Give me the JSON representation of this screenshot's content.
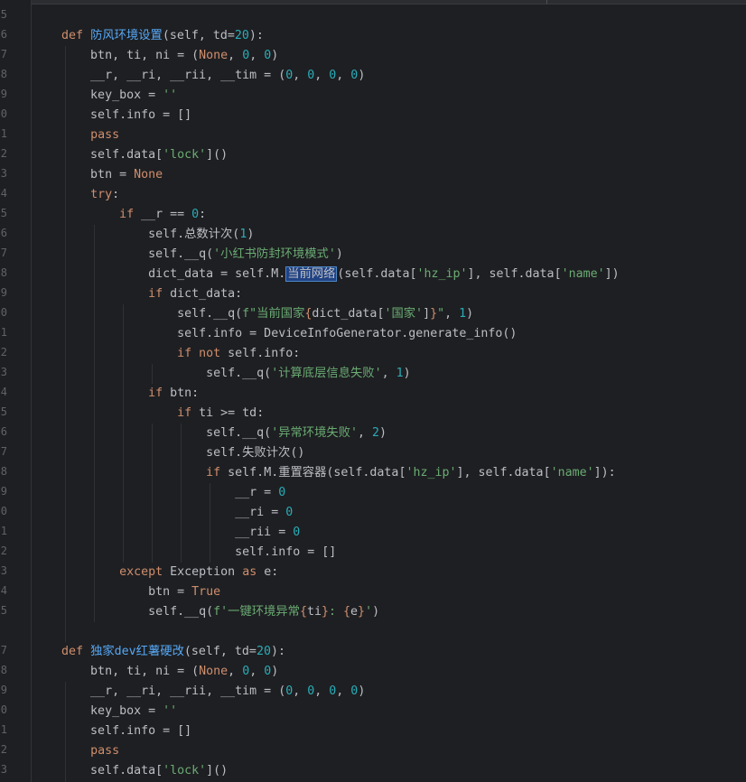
{
  "editor": {
    "line_numbers": [
      "5",
      "6",
      "7",
      "8",
      "9",
      "0",
      "1",
      "2",
      "3",
      "4",
      "5",
      "6",
      "7",
      "8",
      "9",
      "0",
      "1",
      "2",
      "3",
      "4",
      "5",
      "6",
      "7",
      "8",
      "9",
      "0",
      "1",
      "2",
      "3",
      "4",
      "5",
      "",
      "7",
      "8",
      "9",
      "0",
      "1",
      "2",
      "3"
    ],
    "code_lines": [
      [],
      [
        {
          "t": "def ",
          "c": "kw"
        },
        {
          "t": "防风环境设置",
          "c": "fn"
        },
        {
          "t": "(self, td="
        },
        {
          "t": "20",
          "c": "num"
        },
        {
          "t": "):"
        }
      ],
      [
        {
          "t": "    btn, ti, ni = ("
        },
        {
          "t": "None",
          "c": "kw"
        },
        {
          "t": ", "
        },
        {
          "t": "0",
          "c": "num"
        },
        {
          "t": ", "
        },
        {
          "t": "0",
          "c": "num"
        },
        {
          "t": ")"
        }
      ],
      [
        {
          "t": "    __r, __ri, __rii, __tim = ("
        },
        {
          "t": "0",
          "c": "num"
        },
        {
          "t": ", "
        },
        {
          "t": "0",
          "c": "num"
        },
        {
          "t": ", "
        },
        {
          "t": "0",
          "c": "num"
        },
        {
          "t": ", "
        },
        {
          "t": "0",
          "c": "num"
        },
        {
          "t": ")"
        }
      ],
      [
        {
          "t": "    key_box = "
        },
        {
          "t": "''",
          "c": "str"
        }
      ],
      [
        {
          "t": "    self.info = []"
        }
      ],
      [
        {
          "t": "    "
        },
        {
          "t": "pass",
          "c": "kw"
        }
      ],
      [
        {
          "t": "    self.data["
        },
        {
          "t": "'lock'",
          "c": "str"
        },
        {
          "t": "]()"
        }
      ],
      [
        {
          "t": "    btn = "
        },
        {
          "t": "None",
          "c": "kw"
        }
      ],
      [
        {
          "t": "    "
        },
        {
          "t": "try",
          "c": "kw"
        },
        {
          "t": ":"
        }
      ],
      [
        {
          "t": "        "
        },
        {
          "t": "if",
          "c": "kw"
        },
        {
          "t": " __r == "
        },
        {
          "t": "0",
          "c": "num"
        },
        {
          "t": ":"
        }
      ],
      [
        {
          "t": "            self.总数计次("
        },
        {
          "t": "1",
          "c": "num"
        },
        {
          "t": ")"
        }
      ],
      [
        {
          "t": "            self.__q("
        },
        {
          "t": "'小红书防封环境模式'",
          "c": "str"
        },
        {
          "t": ")"
        }
      ],
      [
        {
          "t": "            dict_data = self.M."
        },
        {
          "t": "当前网络",
          "c": "sel"
        },
        {
          "t": "(self.data["
        },
        {
          "t": "'hz_ip'",
          "c": "str"
        },
        {
          "t": "], self.data["
        },
        {
          "t": "'name'",
          "c": "str"
        },
        {
          "t": "])"
        }
      ],
      [
        {
          "t": "            "
        },
        {
          "t": "if",
          "c": "kw"
        },
        {
          "t": " dict_data:"
        }
      ],
      [
        {
          "t": "                self.__q("
        },
        {
          "t": "f\"当前国家",
          "c": "str"
        },
        {
          "t": "{",
          "c": "kw"
        },
        {
          "t": "dict_data["
        },
        {
          "t": "'国家'",
          "c": "str"
        },
        {
          "t": "]"
        },
        {
          "t": "}",
          "c": "kw"
        },
        {
          "t": "\"",
          "c": "str"
        },
        {
          "t": ", "
        },
        {
          "t": "1",
          "c": "num"
        },
        {
          "t": ")"
        }
      ],
      [
        {
          "t": "                self.info = DeviceInfoGenerator.generate_info()"
        }
      ],
      [
        {
          "t": "                "
        },
        {
          "t": "if not",
          "c": "kw"
        },
        {
          "t": " self.info:"
        }
      ],
      [
        {
          "t": "                    self.__q("
        },
        {
          "t": "'计算底层信息失败'",
          "c": "str"
        },
        {
          "t": ", "
        },
        {
          "t": "1",
          "c": "num"
        },
        {
          "t": ")"
        }
      ],
      [
        {
          "t": "            "
        },
        {
          "t": "if",
          "c": "kw"
        },
        {
          "t": " btn:"
        }
      ],
      [
        {
          "t": "                "
        },
        {
          "t": "if",
          "c": "kw"
        },
        {
          "t": " ti >= td:"
        }
      ],
      [
        {
          "t": "                    self.__q("
        },
        {
          "t": "'异常环境失败'",
          "c": "str"
        },
        {
          "t": ", "
        },
        {
          "t": "2",
          "c": "num"
        },
        {
          "t": ")"
        }
      ],
      [
        {
          "t": "                    self.失败计次()"
        }
      ],
      [
        {
          "t": "                    "
        },
        {
          "t": "if",
          "c": "kw"
        },
        {
          "t": " self.M.重置容器(self.data["
        },
        {
          "t": "'hz_ip'",
          "c": "str"
        },
        {
          "t": "], self.data["
        },
        {
          "t": "'name'",
          "c": "str"
        },
        {
          "t": "]):"
        }
      ],
      [
        {
          "t": "                        __r = "
        },
        {
          "t": "0",
          "c": "num"
        }
      ],
      [
        {
          "t": "                        __ri = "
        },
        {
          "t": "0",
          "c": "num"
        }
      ],
      [
        {
          "t": "                        __rii = "
        },
        {
          "t": "0",
          "c": "num"
        }
      ],
      [
        {
          "t": "                        self.info = []"
        }
      ],
      [
        {
          "t": "        "
        },
        {
          "t": "except",
          "c": "kw"
        },
        {
          "t": " Exception "
        },
        {
          "t": "as",
          "c": "kw"
        },
        {
          "t": " e:"
        }
      ],
      [
        {
          "t": "            btn = "
        },
        {
          "t": "True",
          "c": "kw"
        }
      ],
      [
        {
          "t": "            self.__q("
        },
        {
          "t": "f'一键环境异常",
          "c": "str"
        },
        {
          "t": "{",
          "c": "kw"
        },
        {
          "t": "ti"
        },
        {
          "t": "}",
          "c": "kw"
        },
        {
          "t": ": ",
          "c": "str"
        },
        {
          "t": "{",
          "c": "kw"
        },
        {
          "t": "e"
        },
        {
          "t": "}",
          "c": "kw"
        },
        {
          "t": "'",
          "c": "str"
        },
        {
          "t": ")"
        }
      ],
      [],
      [
        {
          "t": "def ",
          "c": "kw"
        },
        {
          "t": "独家dev红薯硬改",
          "c": "fn"
        },
        {
          "t": "(self, td="
        },
        {
          "t": "20",
          "c": "num"
        },
        {
          "t": "):"
        }
      ],
      [
        {
          "t": "    btn, ti, ni = ("
        },
        {
          "t": "None",
          "c": "kw"
        },
        {
          "t": ", "
        },
        {
          "t": "0",
          "c": "num"
        },
        {
          "t": ", "
        },
        {
          "t": "0",
          "c": "num"
        },
        {
          "t": ")"
        }
      ],
      [
        {
          "t": "    __r, __ri, __rii, __tim = ("
        },
        {
          "t": "0",
          "c": "num"
        },
        {
          "t": ", "
        },
        {
          "t": "0",
          "c": "num"
        },
        {
          "t": ", "
        },
        {
          "t": "0",
          "c": "num"
        },
        {
          "t": ", "
        },
        {
          "t": "0",
          "c": "num"
        },
        {
          "t": ")"
        }
      ],
      [
        {
          "t": "    key_box = "
        },
        {
          "t": "''",
          "c": "str"
        }
      ],
      [
        {
          "t": "    self.info = []"
        }
      ],
      [
        {
          "t": "    "
        },
        {
          "t": "pass",
          "c": "kw"
        }
      ],
      [
        {
          "t": "    self.data["
        },
        {
          "t": "'lock'",
          "c": "str"
        },
        {
          "t": "]()"
        }
      ]
    ],
    "colors": {
      "background": "#1e1f22",
      "keyword": "#cf8e6d",
      "number": "#2aacb8",
      "string": "#6aab73",
      "function": "#56a8f5",
      "text": "#bcbec4",
      "selection": "#214283"
    }
  }
}
